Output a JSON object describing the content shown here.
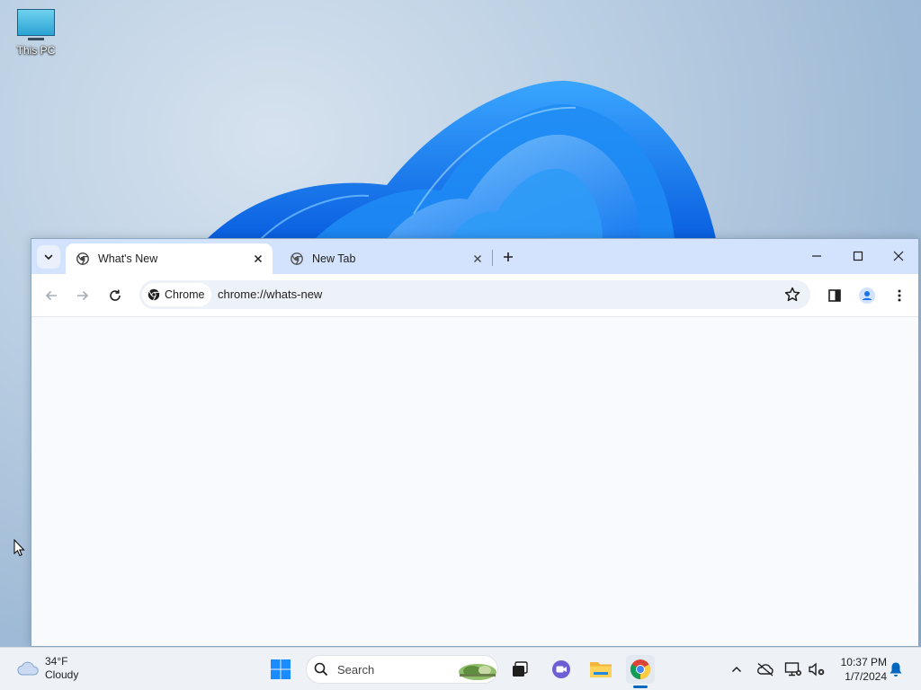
{
  "desktop": {
    "icons": [
      {
        "label": "This PC",
        "icon": "monitor-icon"
      }
    ]
  },
  "browser": {
    "tabs": [
      {
        "title": "What's New",
        "active": true,
        "icon": "chrome-icon"
      },
      {
        "title": "New Tab",
        "active": false,
        "icon": "chrome-icon"
      }
    ],
    "omnibox": {
      "chip_label": "Chrome",
      "url": "chrome://whats-new"
    },
    "colors": {
      "tabstrip": "#d3e3fd",
      "toolbar": "#ffffff",
      "omnibox": "#edf1f8",
      "content": "#f8fafd",
      "profile_accent": "#1a73e8"
    }
  },
  "taskbar": {
    "weather": {
      "temp": "34°F",
      "condition": "Cloudy",
      "icon": "cloud-icon"
    },
    "search_label": "Search",
    "apps": [
      "windows-start-icon",
      "search-icon",
      "task-view-icon",
      "teams-chat-icon",
      "file-explorer-icon",
      "chrome-icon"
    ],
    "tray": [
      "chevron-up-icon",
      "onedrive-offline-icon",
      "network-icon",
      "speaker-muted-icon",
      "notification-bell-icon"
    ],
    "clock": {
      "time": "10:37 PM",
      "date": "1/7/2024"
    },
    "colors": {
      "background": "#eef2f7",
      "active_indicator": "#0067c0"
    }
  }
}
